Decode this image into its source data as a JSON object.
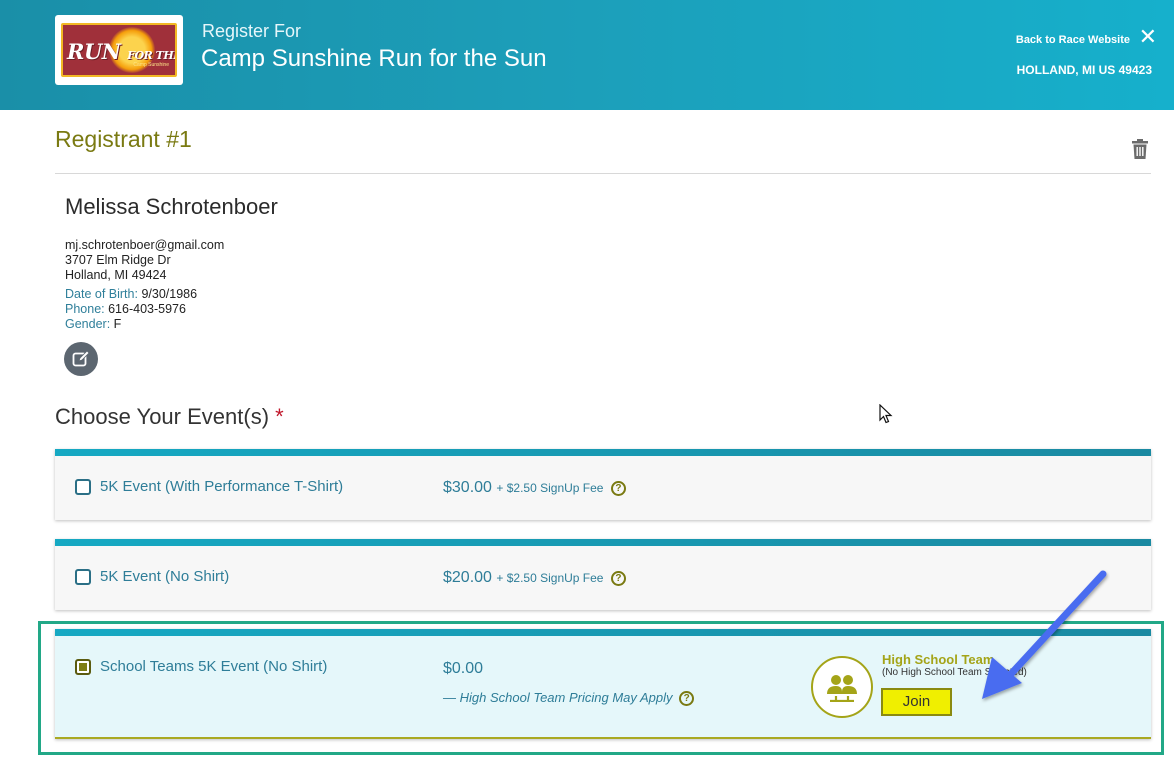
{
  "header": {
    "register_for": "Register For",
    "race_title": "Camp Sunshine Run for the Sun",
    "back_link": "Back to Race Website",
    "location": "HOLLAND, MI US 49423",
    "logo_text": "RUN for the SUN",
    "logo_subtext": "Camp Sunshine",
    "colors": {
      "header_start": "#1a8fa8",
      "header_end": "#16b0cc"
    }
  },
  "registrant": {
    "title": "Registrant #1",
    "name": "Melissa Schrotenboer",
    "email": "mj.schrotenboer@gmail.com",
    "address1": "3707 Elm Ridge Dr",
    "address2": "Holland, MI 49424",
    "dob_label": "Date of Birth:",
    "dob": "9/30/1986",
    "phone_label": "Phone:",
    "phone": "616-403-5976",
    "gender_label": "Gender:",
    "gender": "F",
    "icons": {
      "delete": "trash-icon",
      "edit": "edit-icon"
    }
  },
  "events": {
    "title": "Choose Your Event(s)",
    "required_mark": "*",
    "items": [
      {
        "name": "5K Event (With Performance T-Shirt)",
        "price": "$30.00",
        "fee": "+ $2.50 SignUp Fee",
        "checked": false
      },
      {
        "name": "5K Event (No Shirt)",
        "price": "$20.00",
        "fee": "+ $2.50 SignUp Fee",
        "checked": false
      },
      {
        "name": "School Teams 5K Event (No Shirt)",
        "price": "$0.00",
        "note": "— High School Team Pricing May Apply",
        "checked": true,
        "team": {
          "title": "High School Team",
          "subtitle": "(No High School Team Selected)",
          "join_label": "Join"
        }
      }
    ],
    "help_glyph": "?"
  },
  "colors": {
    "accent_olive": "#7a7a12",
    "link_teal": "#2e7d98",
    "highlight_green": "#22a887",
    "join_yellow": "#f0ef00",
    "annotation_arrow": "#4a6cf0"
  }
}
